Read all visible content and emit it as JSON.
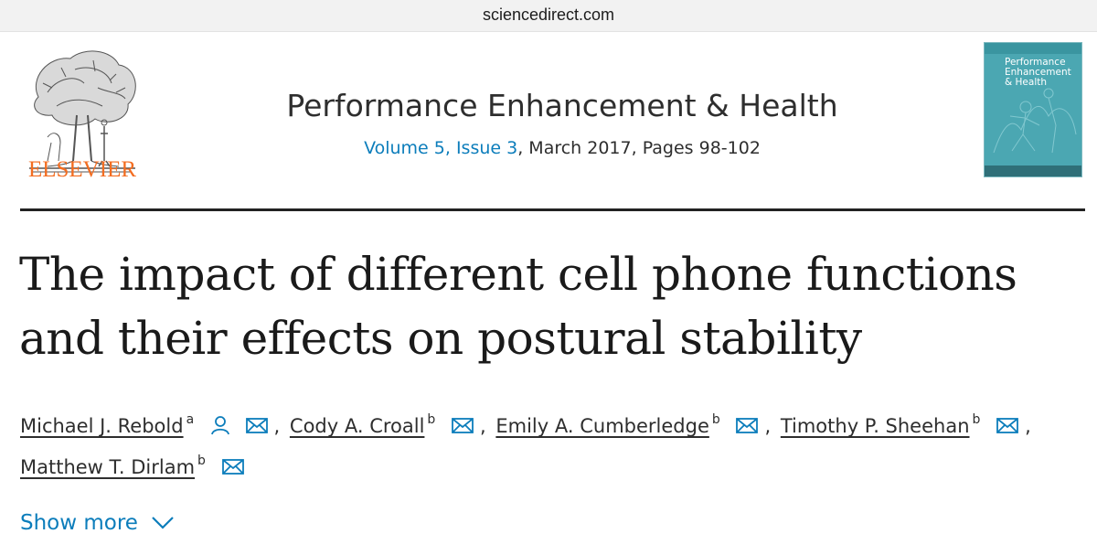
{
  "browser": {
    "url": "sciencedirect.com"
  },
  "publisher": {
    "name": "ELSEVIER"
  },
  "journal": {
    "title": "Performance Enhancement & Health",
    "volume_issue": "Volume 5, Issue 3",
    "date_pages": ", March 2017, Pages 98-102",
    "cover": {
      "title": "Performance Enhancement & Health",
      "color": "#4ba7b2"
    }
  },
  "article": {
    "title_line1": "The impact of different cell phone functions",
    "title_line2": "and their effects on postural stability"
  },
  "authors": [
    {
      "name": "Michael J. Rebold",
      "affiliation": "a",
      "icons": [
        "person-icon",
        "email-icon"
      ]
    },
    {
      "name": "Cody A. Croall",
      "affiliation": "b",
      "icons": [
        "email-icon"
      ]
    },
    {
      "name": "Emily A. Cumberledge",
      "affiliation": "b",
      "icons": [
        "email-icon"
      ]
    },
    {
      "name": "Timothy P. Sheehan",
      "affiliation": "b",
      "icons": [
        "email-icon"
      ]
    },
    {
      "name": "Matthew T. Dirlam",
      "affiliation": "b",
      "icons": [
        "email-icon"
      ]
    }
  ],
  "separator": ",",
  "show_more": {
    "label": "Show more",
    "icon": "chevron-down-icon"
  },
  "colors": {
    "link": "#0c7dbb",
    "publisher": "#f36d21",
    "text": "#2e2e2e"
  }
}
